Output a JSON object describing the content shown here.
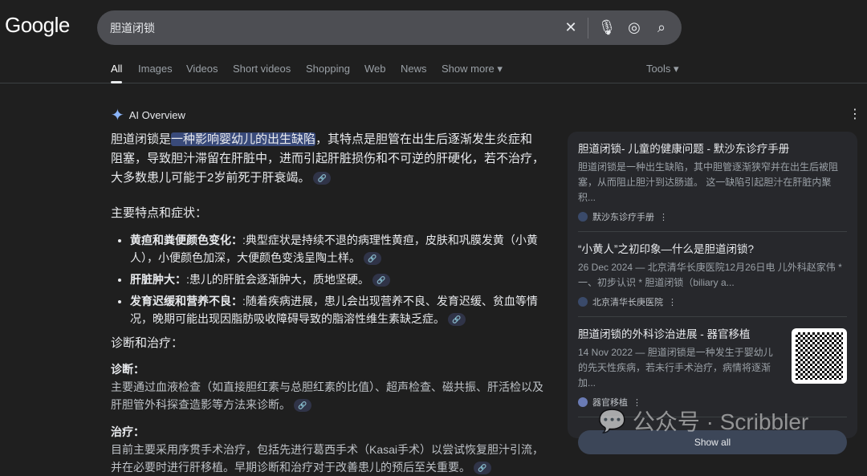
{
  "logo": "Google",
  "search": {
    "query": "胆道闭锁"
  },
  "tabs": [
    "All",
    "Images",
    "Videos",
    "Short videos",
    "Shopping",
    "Web",
    "News",
    "Show more ▾"
  ],
  "tools": "Tools ▾",
  "ai_overview": {
    "label": "AI Overview",
    "intro_pre": "胆道闭锁是",
    "intro_hl": "一种影响婴幼儿的出生缺陷",
    "intro_post": "，其特点是胆管在出生后逐渐发生炎症和阻塞，导致胆汁滞留在肝脏中，进而引起肝脏损伤和不可逆的肝硬化，若不治疗，大多数患儿可能于2岁前死于肝衰竭。",
    "features_heading": "主要特点和症状：",
    "features": [
      {
        "title": "黄疸和粪便颜色变化：",
        "text": ":典型症状是持续不退的病理性黄疸，皮肤和巩膜发黄（小黄人），小便颜色加深，大便颜色变浅呈陶土样。"
      },
      {
        "title": "肝脏肿大：",
        "text": ":患儿的肝脏会逐渐肿大，质地坚硬。"
      },
      {
        "title": "发育迟缓和营养不良：",
        "text": ":随着疾病进展，患儿会出现营养不良、发育迟缓、贫血等情况，晚期可能出现因脂肪吸收障碍导致的脂溶性维生素缺乏症。"
      }
    ],
    "dx_heading": "诊断和治疗：",
    "dx_label": "诊断：",
    "dx_text": "主要通过血液检查（如直接胆红素与总胆红素的比值）、超声检查、磁共振、肝活检以及肝胆管外科探查造影等方法来诊断。",
    "tx_label": "治疗：",
    "tx_text": "目前主要采用序贯手术治疗，包括先进行葛西手术（Kasai手术）以尝试恢复胆汁引流，并在必要时进行肝移植。早期诊断和治疗对于改善患儿的预后至关重要。"
  },
  "sources": [
    {
      "title": "胆道闭锁- 儿童的健康问题 - 默沙东诊疗手册",
      "desc": "胆道闭锁是一种出生缺陷，其中胆管逐渐狭窄并在出生后被阻塞，从而阻止胆汁到达肠道。 这一缺陷引起胆汁在肝脏内聚积...",
      "site": "默沙东诊疗手册"
    },
    {
      "title": "“小黄人”之初印象—什么是胆道闭锁?",
      "desc": "26 Dec 2024 — 北京清华长庚医院12月26日电 儿外科赵家伟 * 一、初步认识 * 胆道闭锁（biliary a...",
      "site": "北京清华长庚医院"
    },
    {
      "title": "胆道闭锁的外科诊治进展 - 器官移植",
      "desc": "14 Nov 2022 — 胆道闭锁是一种发生于婴幼儿的先天性疾病，若未行手术治疗，病情将逐渐加...",
      "site": "器官移植"
    }
  ],
  "show_all": "Show all",
  "watermark": "公众号 · Scribbler"
}
